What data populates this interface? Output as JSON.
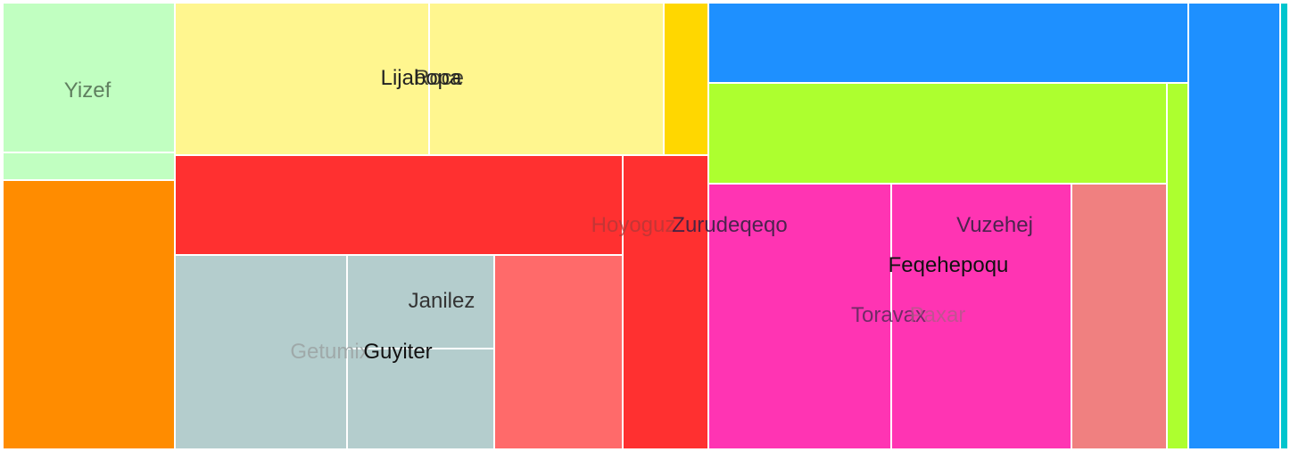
{
  "chart_data": {
    "type": "treemap",
    "labels": [
      {
        "text": "Yizef",
        "color": "#5f7f5f",
        "opacity": 1.0
      },
      {
        "text": "Lijabopa",
        "color": "#222222",
        "opacity": 1.0
      },
      {
        "text": "Roce",
        "color": "#222222",
        "opacity": 0.85
      },
      {
        "text": "Hoyoguz",
        "color": "#b03838",
        "opacity": 0.75
      },
      {
        "text": "Zurudeqeqo",
        "color": "#3a2244",
        "opacity": 0.9
      },
      {
        "text": "Vuzehej",
        "color": "#3a2244",
        "opacity": 0.9
      },
      {
        "text": "Feqehepoqu",
        "color": "#111111",
        "opacity": 1.0
      },
      {
        "text": "Toravax",
        "color": "#5a2a5a",
        "opacity": 0.85
      },
      {
        "text": "Paxar",
        "color": "#b35a8a",
        "opacity": 0.8
      },
      {
        "text": "Janilez",
        "color": "#333333",
        "opacity": 1.0
      },
      {
        "text": "Getumix",
        "color": "#9fa9a9",
        "opacity": 1.0
      },
      {
        "text": "Guyiter",
        "color": "#111111",
        "opacity": 1.0
      }
    ],
    "tiles": [
      {
        "label": "Yizef",
        "color": "#c1ffc1"
      },
      {
        "label": "",
        "color": "#c1ffc1"
      },
      {
        "label": "",
        "color": "#ff8c00"
      },
      {
        "label": "Lijabopa",
        "color": "#fff68f"
      },
      {
        "label": "Roce",
        "color": "#fff68f"
      },
      {
        "label": "",
        "color": "#ffd700"
      },
      {
        "label": "Hoyoguz",
        "color": "#ff3030"
      },
      {
        "label": "Zurudeqeqo",
        "color": "#ff3030"
      },
      {
        "label": "Getumix",
        "color": "#b4cdcd"
      },
      {
        "label": "Janilez",
        "color": "#b4cdcd"
      },
      {
        "label": "Guyiter",
        "color": "#b4cdcd"
      },
      {
        "label": "",
        "color": "#ff6a6a"
      },
      {
        "label": "",
        "color": "#1e90ff"
      },
      {
        "label": "",
        "color": "#adff2f"
      },
      {
        "label": "Toravax",
        "color": "#ff34b3"
      },
      {
        "label": "Paxar",
        "color": "#ff34b3"
      },
      {
        "label": "Feqehepoqu",
        "color": "#ff34b3"
      },
      {
        "label": "Vuzehej",
        "color": "#ff34b3"
      },
      {
        "label": "",
        "color": "#f08080"
      },
      {
        "label": "",
        "color": "#adff2f"
      },
      {
        "label": "",
        "color": "#1e90ff"
      },
      {
        "label": "",
        "color": "#00c5cd"
      }
    ]
  }
}
